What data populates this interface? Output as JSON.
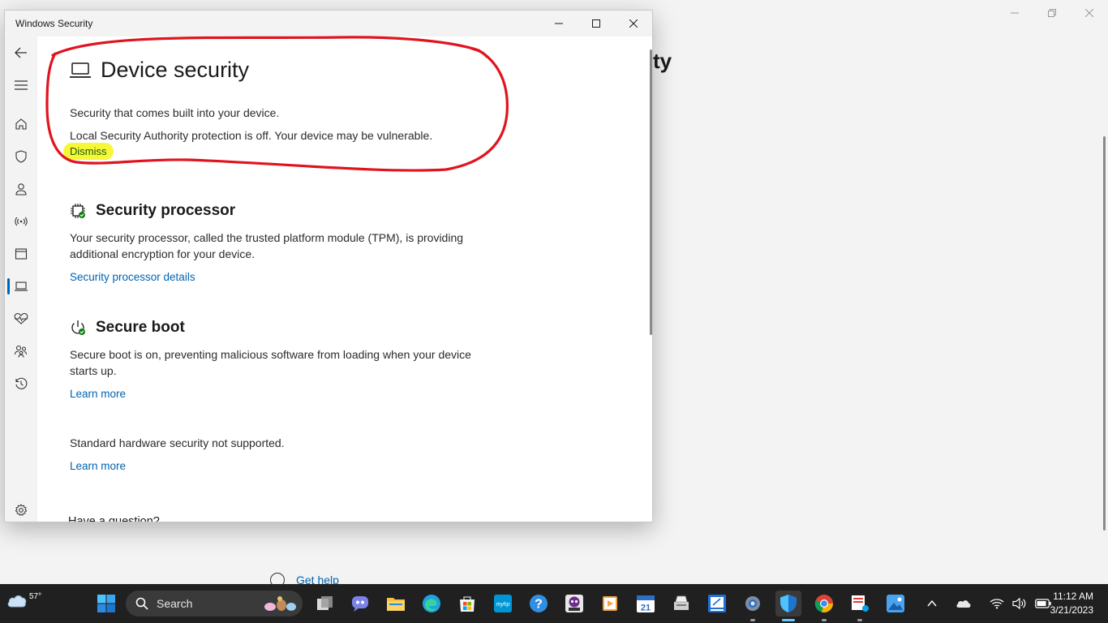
{
  "window": {
    "title": "Windows Security"
  },
  "background_window": {
    "title_fragment": "ty",
    "help_link": "Get help"
  },
  "sidebar": {
    "items": [
      {
        "name": "back",
        "icon": "back-arrow-icon"
      },
      {
        "name": "menu",
        "icon": "hamburger-icon"
      },
      {
        "name": "home",
        "icon": "home-icon"
      },
      {
        "name": "virus-protection",
        "icon": "shield-icon"
      },
      {
        "name": "account-protection",
        "icon": "person-icon"
      },
      {
        "name": "firewall",
        "icon": "antenna-icon"
      },
      {
        "name": "app-browser-control",
        "icon": "browser-window-icon"
      },
      {
        "name": "device-security",
        "icon": "laptop-icon",
        "active": true
      },
      {
        "name": "device-performance",
        "icon": "heart-pulse-icon"
      },
      {
        "name": "family-options",
        "icon": "family-icon"
      },
      {
        "name": "protection-history",
        "icon": "history-icon"
      },
      {
        "name": "settings",
        "icon": "gear-icon"
      }
    ]
  },
  "page": {
    "title": "Device security",
    "subtitle": "Security that comes built into your device.",
    "warning": "Local Security Authority protection is off. Your device may be vulnerable.",
    "dismiss_label": "Dismiss",
    "sections": [
      {
        "title": "Security processor",
        "description": "Your security processor, called the trusted platform module (TPM), is providing additional encryption for your device.",
        "link": "Security processor details"
      },
      {
        "title": "Secure boot",
        "description": "Secure boot is on, preventing malicious software from loading when your device starts up.",
        "link": "Learn more"
      }
    ],
    "hardware_note": "Standard hardware security not supported.",
    "hardware_link": "Learn more",
    "question": "Have a question?"
  },
  "taskbar": {
    "weather_temp": "57°",
    "search_label": "Search",
    "time": "11:12 AM",
    "date": "3/21/2023",
    "calendar_day": "21"
  },
  "colors": {
    "accent": "#0063b1",
    "annotation_red": "#e0141e",
    "highlight_yellow": "#f7f73a",
    "taskbar_bg": "#202020"
  }
}
